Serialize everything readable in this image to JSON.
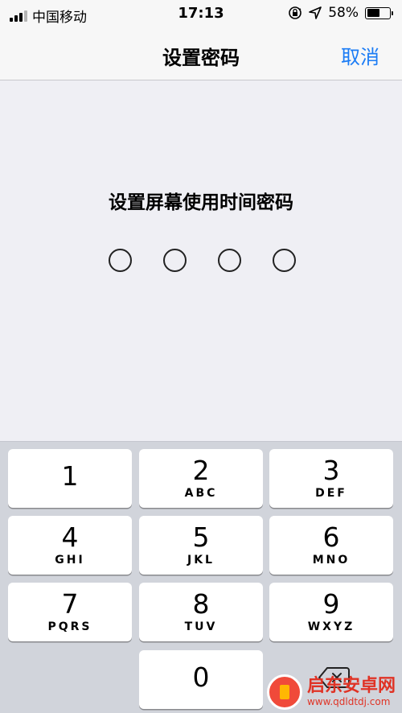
{
  "status_bar": {
    "carrier": "中国移动",
    "time": "17:13",
    "battery_percent": "58%",
    "battery_level": 0.58,
    "icons": [
      "signal-icon",
      "orientation-lock-icon",
      "location-icon",
      "battery-icon"
    ]
  },
  "nav": {
    "title": "设置密码",
    "cancel_label": "取消"
  },
  "main": {
    "prompt": "设置屏幕使用时间密码",
    "passcode_length": 4,
    "entered_digits": 0
  },
  "keypad": {
    "keys": [
      {
        "num": "1",
        "letters": ""
      },
      {
        "num": "2",
        "letters": "ABC"
      },
      {
        "num": "3",
        "letters": "DEF"
      },
      {
        "num": "4",
        "letters": "GHI"
      },
      {
        "num": "5",
        "letters": "JKL"
      },
      {
        "num": "6",
        "letters": "MNO"
      },
      {
        "num": "7",
        "letters": "PQRS"
      },
      {
        "num": "8",
        "letters": "TUV"
      },
      {
        "num": "9",
        "letters": "WXYZ"
      },
      {
        "num": "0",
        "letters": ""
      }
    ]
  },
  "watermark": {
    "name": "启东安卓网",
    "url": "www.qdldtdj.com"
  },
  "colors": {
    "accent": "#1b7cf5",
    "background": "#efeff4",
    "keypad_bg": "#d1d4db"
  }
}
